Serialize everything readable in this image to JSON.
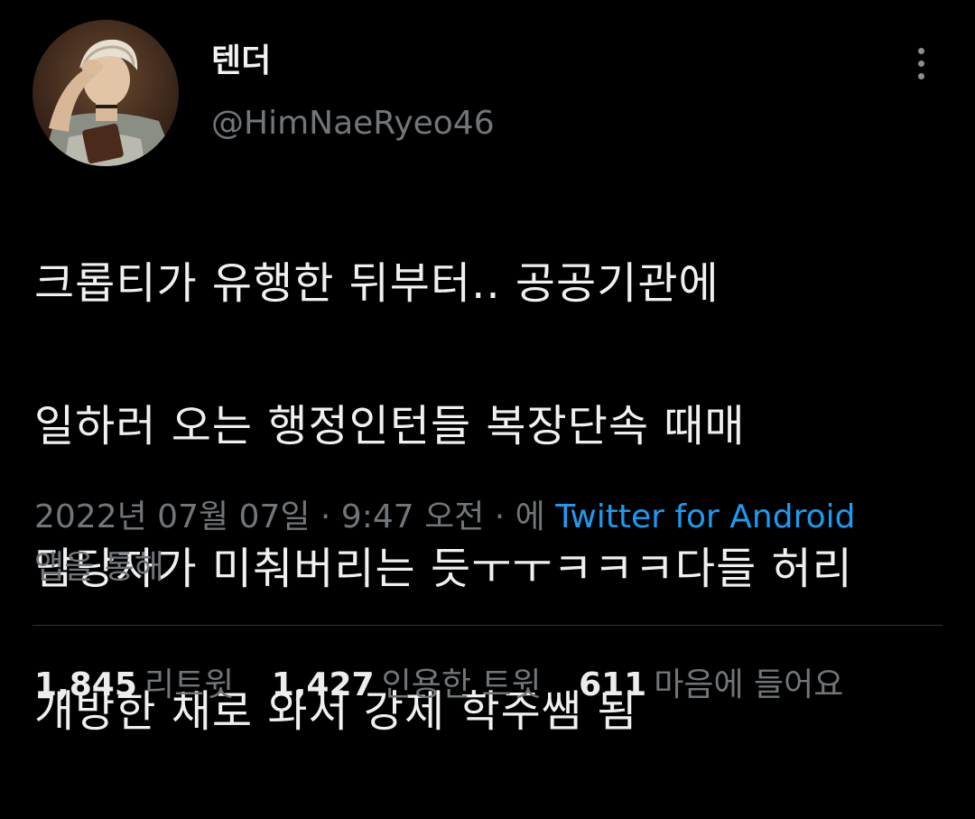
{
  "author": {
    "display_name": "텐더",
    "handle": "@HimNaeRyeo46",
    "avatar_icon": "profile-avatar-painting"
  },
  "tweet": {
    "lines": [
      "크롭티가 유행한 뒤부터.. 공공기관에",
      "일하러 오는 행정인턴들 복장단속 때매",
      "담당자가 미춰버리는 듯ㅜㅜㅋㅋㅋ다들 허리",
      "개방한 채로 와서 강제 학주쌤 됨"
    ]
  },
  "meta": {
    "timestamp": "2022년 07월 07일 · 9:47 오전 · 에",
    "source": "Twitter for Android",
    "suffix": "앱을 통해"
  },
  "stats": {
    "retweets_count": "1,845",
    "retweets_label": "리트윗",
    "quotes_count": "1,427",
    "quotes_label": "인용한 트윗",
    "likes_count": "611",
    "likes_label": "마음에 들어요"
  },
  "colors": {
    "background": "#000000",
    "text": "#e7e9ea",
    "secondary": "#71767b",
    "link": "#1d9bf0",
    "divider": "#2f3336"
  }
}
